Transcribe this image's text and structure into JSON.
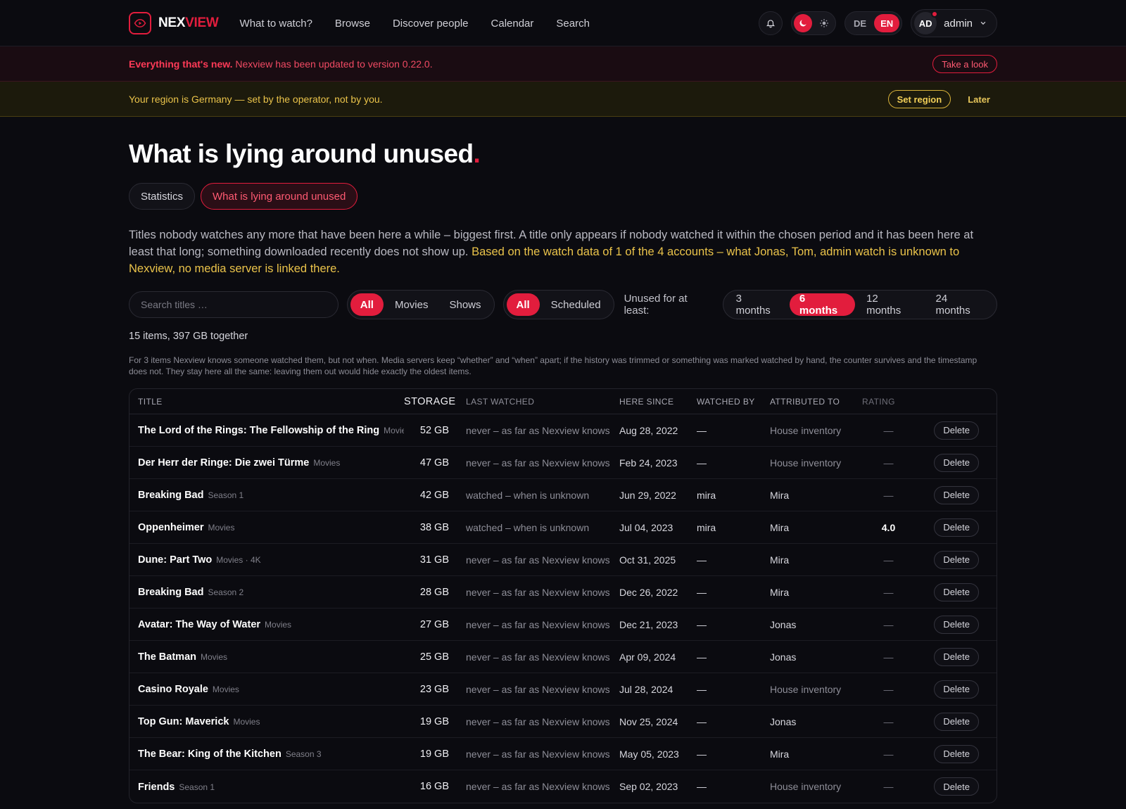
{
  "nav": {
    "brand_a": "NEX",
    "brand_b": "VIEW",
    "links": [
      "What to watch?",
      "Browse",
      "Discover people",
      "Calendar",
      "Search"
    ],
    "lang": [
      "DE",
      "EN"
    ],
    "avatar": "AD",
    "user": "admin"
  },
  "banner_new": {
    "strong": "Everything that's new.",
    "text": " Nexview has been updated to version 0.22.0.",
    "action": "Take a look"
  },
  "banner_region": {
    "text": "Your region is Germany — set by the operator, not by you.",
    "action": "Set region",
    "later": "Later"
  },
  "page": {
    "title": "What is lying around unused",
    "title_dot": ".",
    "tabs": [
      "Statistics",
      "What is lying around unused"
    ],
    "intro": "Titles nobody watches any more that have been here a while – biggest first. A title only appears if nobody watched it within the chosen period and it has been here at least that long; something downloaded recently does not show up. ",
    "intro_hl": "Based on the watch data of 1 of the 4 accounts – what Jonas, Tom, admin watch is unknown to Nexview, no media server is linked there."
  },
  "filters": {
    "search_placeholder": "Search titles …",
    "type": [
      "All",
      "Movies",
      "Shows"
    ],
    "scope": [
      "All",
      "Scheduled"
    ],
    "unused_label": "Unused for at least:",
    "periods": [
      "3 months",
      "6 months",
      "12 months",
      "24 months"
    ]
  },
  "summary": "15 items, 397 GB together",
  "note": "For 3 items Nexview knows someone watched them, but not when. Media servers keep “whether” and “when” apart; if the history was trimmed or something was marked watched by hand, the counter survives and the timestamp does not. They stay here all the same: leaving them out would hide exactly the oldest items.",
  "table": {
    "headers": [
      "Title",
      "Storage",
      "Last watched",
      "Here since",
      "Watched by",
      "Attributed to",
      "Rating"
    ],
    "delete_label": "Delete",
    "rows": [
      {
        "title": "The Lord of the Rings: The Fellowship of the Ring",
        "kind": "Movies",
        "storage": "52 GB",
        "last": "never – as far as Nexview knows",
        "since": "Aug 28, 2022",
        "by": "—",
        "attr": "House inventory",
        "rating": "—"
      },
      {
        "title": "Der Herr der Ringe: Die zwei Türme",
        "kind": "Movies",
        "storage": "47 GB",
        "last": "never – as far as Nexview knows",
        "since": "Feb 24, 2023",
        "by": "—",
        "attr": "House inventory",
        "rating": "—"
      },
      {
        "title": "Breaking Bad",
        "kind": "Season 1",
        "storage": "42 GB",
        "last": "watched – when is unknown",
        "since": "Jun 29, 2022",
        "by": "mira",
        "attr": "Mira",
        "rating": "—"
      },
      {
        "title": "Oppenheimer",
        "kind": "Movies",
        "storage": "38 GB",
        "last": "watched – when is unknown",
        "since": "Jul 04, 2023",
        "by": "mira",
        "attr": "Mira",
        "rating": "4.0"
      },
      {
        "title": "Dune: Part Two",
        "kind": "Movies · 4K",
        "storage": "31 GB",
        "last": "never – as far as Nexview knows",
        "since": "Oct 31, 2025",
        "by": "—",
        "attr": "Mira",
        "rating": "—"
      },
      {
        "title": "Breaking Bad",
        "kind": "Season 2",
        "storage": "28 GB",
        "last": "never – as far as Nexview knows",
        "since": "Dec 26, 2022",
        "by": "—",
        "attr": "Mira",
        "rating": "—"
      },
      {
        "title": "Avatar: The Way of Water",
        "kind": "Movies",
        "storage": "27 GB",
        "last": "never – as far as Nexview knows",
        "since": "Dec 21, 2023",
        "by": "—",
        "attr": "Jonas",
        "rating": "—"
      },
      {
        "title": "The Batman",
        "kind": "Movies",
        "storage": "25 GB",
        "last": "never – as far as Nexview knows",
        "since": "Apr 09, 2024",
        "by": "—",
        "attr": "Jonas",
        "rating": "—"
      },
      {
        "title": "Casino Royale",
        "kind": "Movies",
        "storage": "23 GB",
        "last": "never – as far as Nexview knows",
        "since": "Jul 28, 2024",
        "by": "—",
        "attr": "House inventory",
        "rating": "—"
      },
      {
        "title": "Top Gun: Maverick",
        "kind": "Movies",
        "storage": "19 GB",
        "last": "never – as far as Nexview knows",
        "since": "Nov 25, 2024",
        "by": "—",
        "attr": "Jonas",
        "rating": "—"
      },
      {
        "title": "The Bear: King of the Kitchen",
        "kind": "Season 3",
        "storage": "19 GB",
        "last": "never – as far as Nexview knows",
        "since": "May 05, 2023",
        "by": "—",
        "attr": "Mira",
        "rating": "—"
      },
      {
        "title": "Friends",
        "kind": "Season 1",
        "storage": "16 GB",
        "last": "never – as far as Nexview knows",
        "since": "Sep 02, 2023",
        "by": "—",
        "attr": "House inventory",
        "rating": "—"
      }
    ]
  },
  "colors": {
    "accent": "#e21d3d",
    "warn": "#eac34a",
    "background": "#0b0b10"
  }
}
